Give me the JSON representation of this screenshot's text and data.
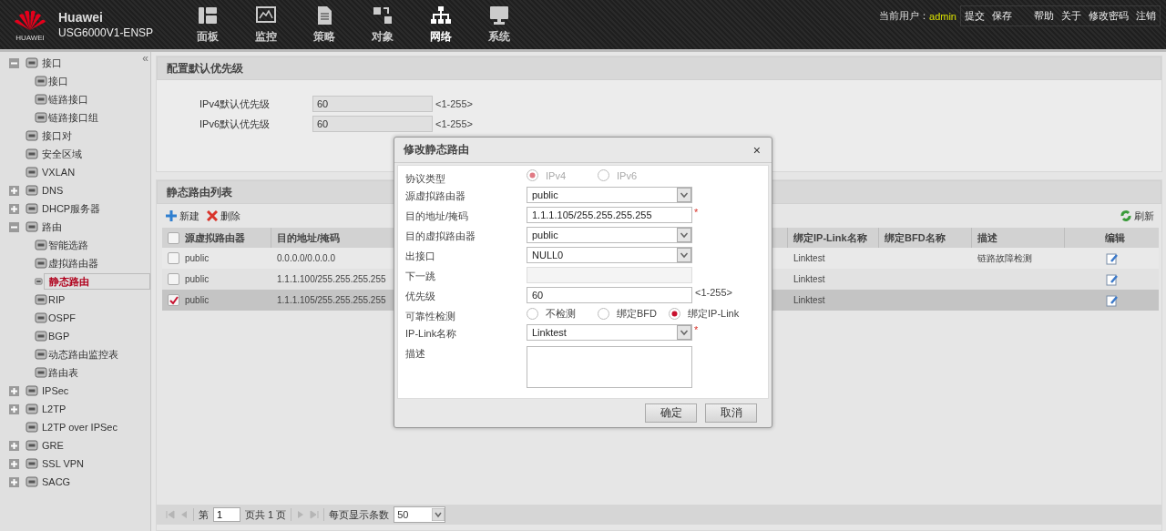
{
  "header": {
    "brand": "HUAWEI",
    "title": "Huawei",
    "model": "USG6000V1-ENSP",
    "nav": [
      {
        "label": "面板",
        "selected": false
      },
      {
        "label": "监控",
        "selected": false
      },
      {
        "label": "策略",
        "selected": false
      },
      {
        "label": "对象",
        "selected": false
      },
      {
        "label": "网络",
        "selected": true
      },
      {
        "label": "系统",
        "selected": false
      }
    ],
    "user_label": "当前用户：",
    "user": "admin",
    "actions": [
      "提交",
      "保存"
    ],
    "links": [
      "帮助",
      "关于",
      "修改密码",
      "注销"
    ]
  },
  "sidebar": {
    "collapse": "«",
    "items": [
      {
        "label": "接口",
        "expanded": true,
        "selected": false,
        "children": [
          {
            "label": "接口",
            "selected": false
          },
          {
            "label": "链路接口",
            "selected": false
          },
          {
            "label": "链路接口组",
            "selected": false
          }
        ]
      },
      {
        "label": "接口对",
        "selected": false
      },
      {
        "label": "安全区域",
        "selected": false
      },
      {
        "label": "VXLAN",
        "selected": false
      },
      {
        "label": "DNS",
        "expanded": false,
        "selected": false
      },
      {
        "label": "DHCP服务器",
        "expanded": false,
        "selected": false
      },
      {
        "label": "路由",
        "expanded": true,
        "selected": false,
        "children": [
          {
            "label": "智能选路",
            "selected": false
          },
          {
            "label": "虚拟路由器",
            "selected": false
          },
          {
            "label": "静态路由",
            "selected": true
          },
          {
            "label": "RIP",
            "selected": false
          },
          {
            "label": "OSPF",
            "selected": false
          },
          {
            "label": "BGP",
            "selected": false
          },
          {
            "label": "动态路由监控表",
            "selected": false
          },
          {
            "label": "路由表",
            "selected": false
          }
        ]
      },
      {
        "label": "IPSec",
        "expanded": false,
        "selected": false
      },
      {
        "label": "L2TP",
        "expanded": false,
        "selected": false
      },
      {
        "label": "L2TP over IPSec",
        "selected": false
      },
      {
        "label": "GRE",
        "expanded": false,
        "selected": false
      },
      {
        "label": "SSL VPN",
        "expanded": false,
        "selected": false
      },
      {
        "label": "SACG",
        "expanded": false,
        "selected": false
      }
    ]
  },
  "priority_section": {
    "title": "配置默认优先级",
    "fields": [
      {
        "label": "IPv4默认优先级",
        "value": "60",
        "hint": "<1-255>"
      },
      {
        "label": "IPv6默认优先级",
        "value": "60",
        "hint": "<1-255>"
      }
    ]
  },
  "routes_section": {
    "title": "静态路由列表",
    "new": "新建",
    "delete": "删除",
    "refresh": "刷新",
    "all_checked": false,
    "columns": [
      "源虚拟路由器",
      "目的地址/掩码",
      "绑定IP-Link名称",
      "绑定BFD名称",
      "描述",
      "编辑"
    ],
    "rows": [
      {
        "source": "public",
        "destination": "0.0.0.0/0.0.0.0",
        "ip_link": "Linktest",
        "description": "链路故障检测",
        "checked": false,
        "selected": false
      },
      {
        "source": "public",
        "destination": "1.1.1.100/255.255.255.255",
        "ip_link": "Linktest",
        "checked": false,
        "selected": false
      },
      {
        "source": "public",
        "destination": "1.1.1.105/255.255.255.255",
        "ip_link": "Linktest",
        "checked": true,
        "selected": true
      }
    ],
    "pager": {
      "page_prefix": "第",
      "page": "1",
      "page_suffix": "页共 1 页",
      "size_label": "每页显示条数",
      "size": "50"
    }
  },
  "dialog": {
    "title": "修改静态路由",
    "close": "×",
    "fields": [
      {
        "kind": "radio",
        "label": "协议类型",
        "disabled": true,
        "options": [
          {
            "label": "IPv4",
            "selected": true
          },
          {
            "label": "IPv6",
            "selected": false
          }
        ]
      },
      {
        "kind": "select",
        "label": "源虚拟路由器",
        "value": "public",
        "required": false
      },
      {
        "kind": "text",
        "label": "目的地址/掩码",
        "value": "1.1.1.105/255.255.255.255",
        "required": true,
        "disabled": false
      },
      {
        "kind": "select",
        "label": "目的虚拟路由器",
        "value": "public",
        "required": false
      },
      {
        "kind": "select",
        "label": "出接口",
        "value": "NULL0",
        "required": false
      },
      {
        "kind": "text",
        "label": "下一跳",
        "required": false,
        "disabled": true
      },
      {
        "kind": "text",
        "label": "优先级",
        "value": "60",
        "hint": "<1-255>",
        "required": false,
        "disabled": false
      },
      {
        "kind": "radio",
        "label": "可靠性检测",
        "disabled": false,
        "options": [
          {
            "label": "不检测",
            "selected": false
          },
          {
            "label": "绑定BFD",
            "selected": false
          },
          {
            "label": "绑定IP-Link",
            "selected": true
          }
        ]
      },
      {
        "kind": "select",
        "label": "IP-Link名称",
        "value": "Linktest",
        "required": true
      },
      {
        "kind": "textarea",
        "label": "描述"
      }
    ],
    "required_mark": "*",
    "buttons": [
      "确定",
      "取消"
    ]
  }
}
